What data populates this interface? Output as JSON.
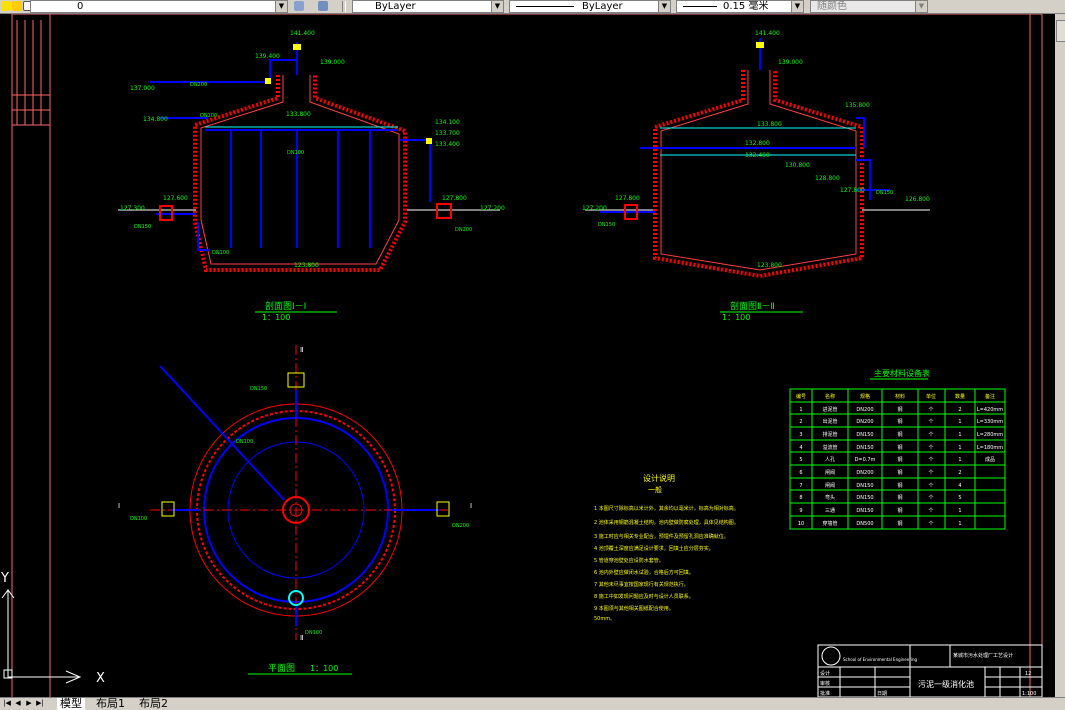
{
  "toolbar": {
    "layer_name": "0",
    "color_control": "ByLayer",
    "linetype_control": "ByLayer",
    "lineweight_control": "0.15 毫米",
    "plotstyle_control": "随颜色"
  },
  "section1": {
    "title": "剖面图Ⅰ－Ⅰ",
    "scale": "1：100",
    "elevations": [
      "141.400",
      "139.400",
      "139.000",
      "137.000",
      "134.800",
      "133.800",
      "134.100",
      "133.700",
      "133.400",
      "127.600",
      "127.800",
      "127.300",
      "127.200",
      "123.800"
    ],
    "pipe_labels": [
      "DN200",
      "DN100",
      "DN100",
      "DN150",
      "DN200",
      "DN100"
    ]
  },
  "section2": {
    "title": "剖面图Ⅱ－Ⅱ",
    "scale": "1：100",
    "elevations": [
      "141.400",
      "139.000",
      "135.800",
      "133.800",
      "132.800",
      "132.400",
      "130.800",
      "128.800",
      "127.800",
      "127.800",
      "126.800",
      "127.200",
      "123.800"
    ],
    "pipe_labels": [
      "DN150",
      "DN150"
    ]
  },
  "plan": {
    "title": "平面图",
    "scale": "1：100",
    "section_markers": [
      "Ⅰ",
      "Ⅰ",
      "Ⅱ",
      "Ⅱ"
    ],
    "pipe_labels": [
      "DN150",
      "DN100",
      "DN200",
      "DN100",
      "DN100"
    ]
  },
  "notes": {
    "heading": "设计说明",
    "subheading": "一般",
    "items": [
      "1 本图尺寸除标高以米计外，其余均以毫米计，标高为相对标高。",
      "2 池体采用钢筋混凝土结构，池内壁做防腐处理，具体见结构图。",
      "3 施工时应与相关专业配合，预埋件及预留孔洞应准确就位。",
      "4 池顶覆土深度应满足设计要求，回填土应分层夯实。",
      "5 管道穿池壁处应设防水套管。",
      "6 池内外壁应做闭水试验，合格后方可回填。",
      "7 其他未尽事宜按国家现行有关规范执行。",
      "8 施工中如发现问题应及时与设计人员联系。",
      "9 本图须与其他相关图纸配合使用。",
      "50mm。"
    ]
  },
  "material_table": {
    "title": "主要材料设备表",
    "headers": [
      "编号",
      "名称",
      "规格",
      "材料",
      "单位",
      "数量",
      "备注"
    ],
    "rows": [
      [
        "1",
        "进泥管",
        "DN200",
        "钢",
        "个",
        "2",
        "L=420mm"
      ],
      [
        "2",
        "出泥管",
        "DN200",
        "钢",
        "个",
        "1",
        "L=330mm"
      ],
      [
        "3",
        "排泥管",
        "DN150",
        "钢",
        "个",
        "1",
        "L=280mm"
      ],
      [
        "4",
        "溢流管",
        "DN150",
        "钢",
        "个",
        "1",
        "L=180mm"
      ],
      [
        "5",
        "人孔",
        "D=0.7m",
        "钢",
        "个",
        "1",
        "成品"
      ],
      [
        "6",
        "闸阀",
        "DN200",
        "钢",
        "个",
        "2",
        ""
      ],
      [
        "7",
        "闸阀",
        "DN150",
        "钢",
        "个",
        "4",
        ""
      ],
      [
        "8",
        "弯头",
        "DN150",
        "钢",
        "个",
        "5",
        ""
      ],
      [
        "9",
        "三通",
        "DN150",
        "钢",
        "个",
        "1",
        ""
      ],
      [
        "10",
        "穿墙管",
        "DN500",
        "钢",
        "个",
        "1",
        ""
      ]
    ]
  },
  "title_block": {
    "school_en": "School of Environmental Engineering",
    "project": "某城市污水处理厂工艺设计",
    "drawing_name": "污泥一级消化池",
    "drawing_no": "12",
    "scale": "1:100",
    "label_design": "设计",
    "label_check": "审核",
    "label_approve": "批准",
    "label_date": "日期"
  },
  "ucs": {
    "x_label": "X",
    "y_label": "Y"
  },
  "tabs": [
    "模型",
    "布局1",
    "布局2"
  ],
  "colors": {
    "background": "#000000",
    "wall": "#ff0000",
    "pipe": "#0000ff",
    "dim": "#00ff00",
    "text": "#ffff00",
    "frame": "#ff6666"
  }
}
